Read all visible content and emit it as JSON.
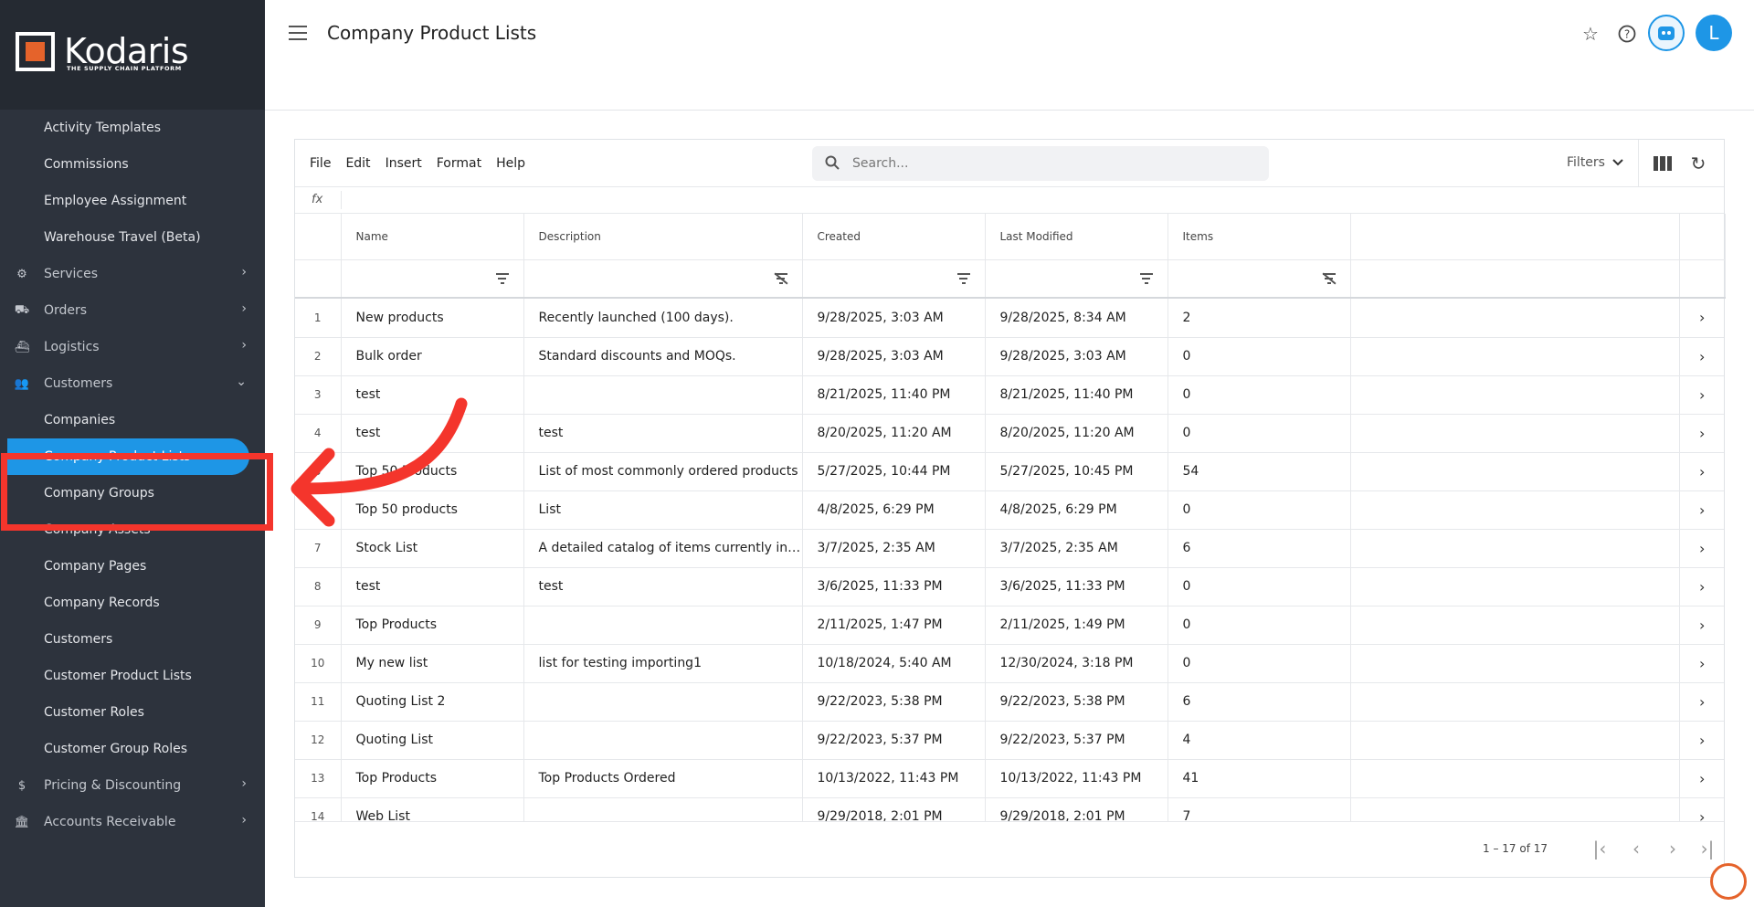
{
  "brand": {
    "name": "Kodaris",
    "tagline": "THE SUPPLY CHAIN PLATFORM"
  },
  "sidebar": {
    "items": [
      {
        "label": "Activity Templates",
        "kind": "sub"
      },
      {
        "label": "Commissions",
        "kind": "sub"
      },
      {
        "label": "Employee Assignment",
        "kind": "sub"
      },
      {
        "label": "Warehouse Travel (Beta)",
        "kind": "sub"
      },
      {
        "label": "Services",
        "kind": "top",
        "icon": "services-icon"
      },
      {
        "label": "Orders",
        "kind": "top",
        "icon": "truck-icon"
      },
      {
        "label": "Logistics",
        "kind": "top",
        "icon": "logistics-icon"
      },
      {
        "label": "Customers",
        "kind": "top",
        "icon": "people-icon"
      },
      {
        "label": "Companies",
        "kind": "sub"
      },
      {
        "label": "Company Product Lists",
        "kind": "active"
      },
      {
        "label": "Company Groups",
        "kind": "sub"
      },
      {
        "label": "Company Assets",
        "kind": "sub"
      },
      {
        "label": "Company Pages",
        "kind": "sub"
      },
      {
        "label": "Company Records",
        "kind": "sub"
      },
      {
        "label": "Customers",
        "kind": "sub"
      },
      {
        "label": "Customer Product Lists",
        "kind": "sub"
      },
      {
        "label": "Customer Roles",
        "kind": "sub"
      },
      {
        "label": "Customer Group Roles",
        "kind": "sub"
      },
      {
        "label": "Pricing & Discounting",
        "kind": "top",
        "icon": "dollar-icon"
      },
      {
        "label": "Accounts Receivable",
        "kind": "top",
        "icon": "bank-icon"
      }
    ]
  },
  "header": {
    "title": "Company Product Lists",
    "avatar_initial": "L"
  },
  "toolbar": {
    "menus": [
      "File",
      "Edit",
      "Insert",
      "Format",
      "Help"
    ],
    "search_placeholder": "Search...",
    "filters_label": "Filters"
  },
  "formula_bar": {
    "label": "fx"
  },
  "table": {
    "columns": [
      "Name",
      "Description",
      "Created",
      "Last Modified",
      "Items"
    ],
    "rows": [
      [
        "1",
        "New products",
        "Recently launched (100 days).",
        "9/28/2025, 3:03 AM",
        "9/28/2025, 8:34 AM",
        "2"
      ],
      [
        "2",
        "Bulk order",
        "Standard discounts and MOQs.",
        "9/28/2025, 3:03 AM",
        "9/28/2025, 3:03 AM",
        "0"
      ],
      [
        "3",
        "test",
        "",
        "8/21/2025, 11:40 PM",
        "8/21/2025, 11:40 PM",
        "0"
      ],
      [
        "4",
        "test",
        "test",
        "8/20/2025, 11:20 AM",
        "8/20/2025, 11:20 AM",
        "0"
      ],
      [
        "5",
        "Top 50 Products",
        "List of most commonly ordered products",
        "5/27/2025, 10:44 PM",
        "5/27/2025, 10:45 PM",
        "54"
      ],
      [
        "6",
        "Top 50 products",
        "List",
        "4/8/2025, 6:29 PM",
        "4/8/2025, 6:29 PM",
        "0"
      ],
      [
        "7",
        "Stock List",
        "A detailed catalog of items currently in st...",
        "3/7/2025, 2:35 AM",
        "3/7/2025, 2:35 AM",
        "6"
      ],
      [
        "8",
        "test",
        "test",
        "3/6/2025, 11:33 PM",
        "3/6/2025, 11:33 PM",
        "0"
      ],
      [
        "9",
        "Top Products",
        "",
        "2/11/2025, 1:47 PM",
        "2/11/2025, 1:49 PM",
        "0"
      ],
      [
        "10",
        "My new list",
        "list for testing importing1",
        "10/18/2024, 5:40 AM",
        "12/30/2024, 3:18 PM",
        "0"
      ],
      [
        "11",
        "Quoting List 2",
        "",
        "9/22/2023, 5:38 PM",
        "9/22/2023, 5:38 PM",
        "6"
      ],
      [
        "12",
        "Quoting List",
        "",
        "9/22/2023, 5:37 PM",
        "9/22/2023, 5:37 PM",
        "4"
      ],
      [
        "13",
        "Top Products",
        "Top Products Ordered",
        "10/13/2022, 11:43 PM",
        "10/13/2022, 11:43 PM",
        "41"
      ],
      [
        "14",
        "Web List",
        "",
        "9/29/2018, 2:01 PM",
        "9/29/2018, 2:01 PM",
        "7"
      ]
    ]
  },
  "pagination": {
    "range": "1 – 17 of 17"
  },
  "colors": {
    "accent": "#1e96e6",
    "sidebar": "#2d333d",
    "annotation": "#f4352c",
    "brand_orange": "#e5632b"
  }
}
